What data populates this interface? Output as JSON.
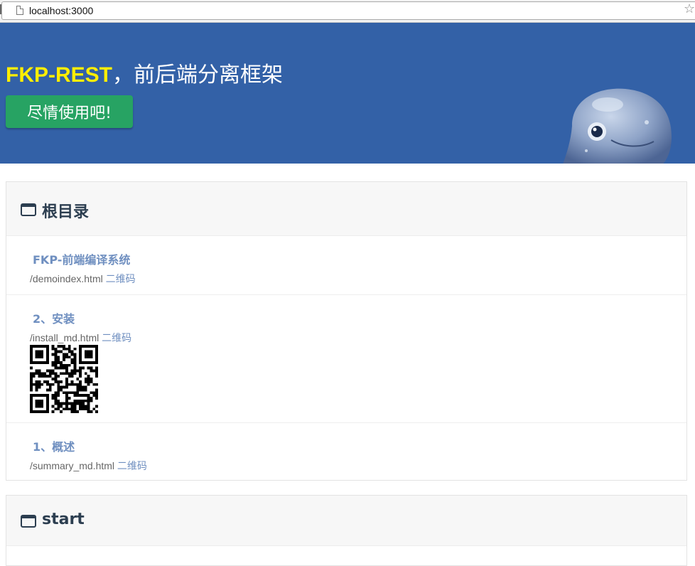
{
  "browser": {
    "url": "localhost:3000"
  },
  "hero": {
    "brand": "FKP-REST",
    "tagline": "，前后端分离框架",
    "cta_label": "尽情使用吧!",
    "colors": {
      "background": "#3361a7",
      "brand": "#ffee00",
      "cta": "#27a363"
    }
  },
  "sections": [
    {
      "title": "根目录",
      "items": [
        {
          "title": "FKP-前端编译系统",
          "path": "/demoindex.html",
          "qr_label": "二维码"
        },
        {
          "title": "2、安装",
          "path": "/install_md.html",
          "qr_label": "二维码",
          "qr_visible": true
        },
        {
          "title": "1、概述",
          "path": "/summary_md.html",
          "qr_label": "二维码"
        }
      ]
    },
    {
      "title": "start",
      "items": []
    }
  ],
  "icons": {
    "folder": "folder-icon",
    "page": "page-icon",
    "star": "star-icon",
    "qr": "qr-code-image",
    "mascot": "mascot-image"
  }
}
